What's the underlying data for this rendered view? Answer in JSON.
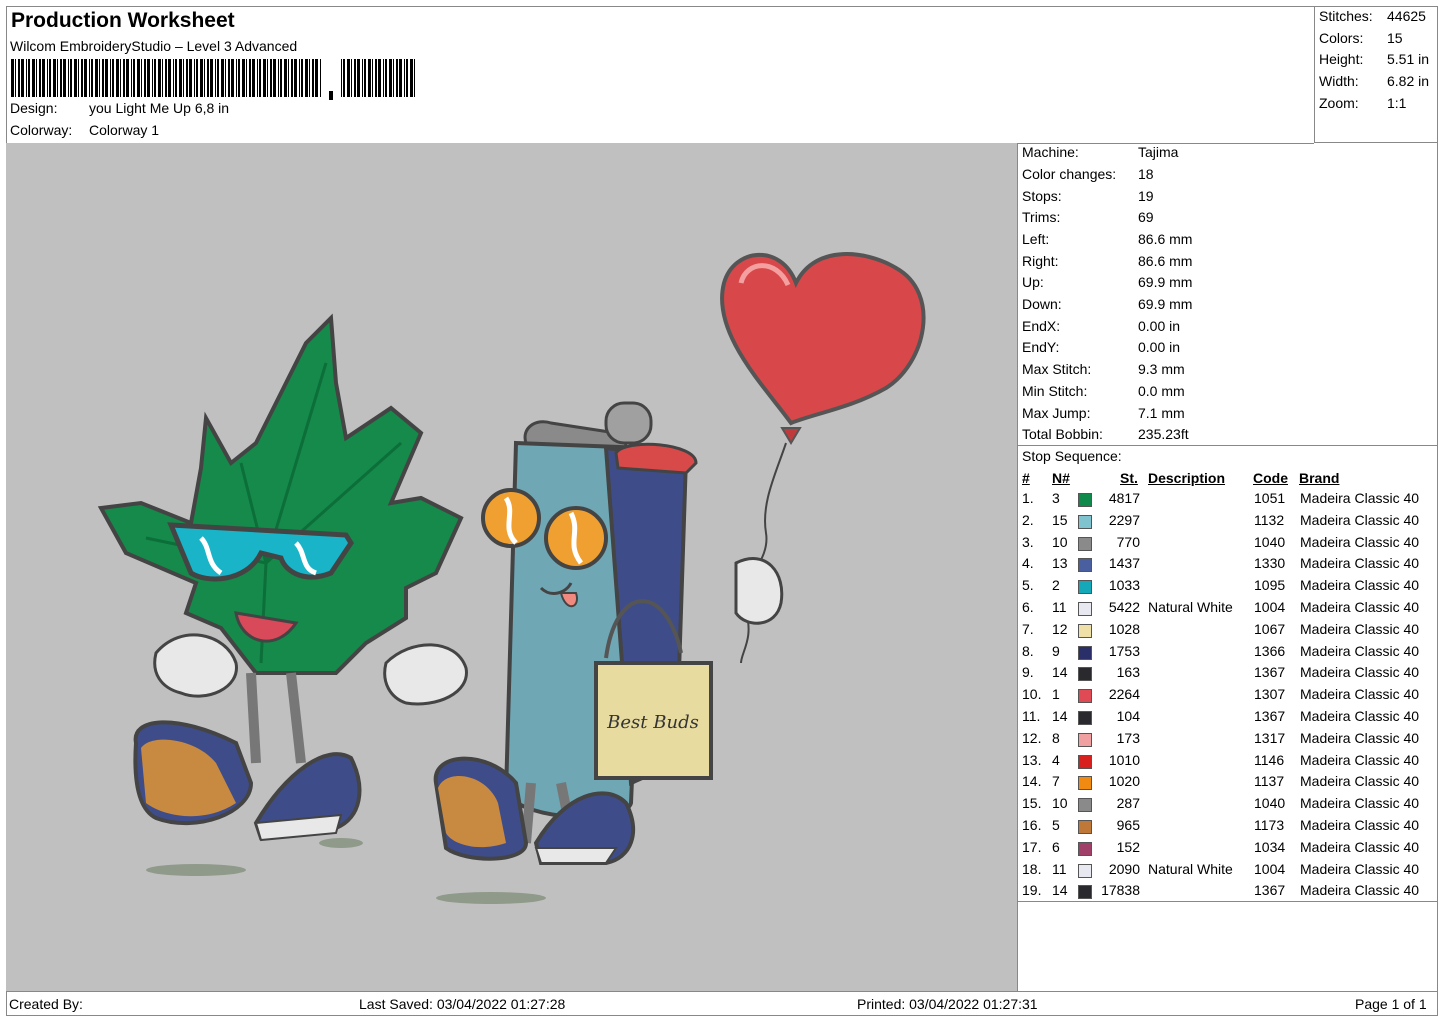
{
  "header": {
    "title": "Production Worksheet",
    "software": "Wilcom EmbroideryStudio – Level 3 Advanced",
    "design_label": "Design:",
    "design_value": "you Light Me Up 6,8 in",
    "colorway_label": "Colorway:",
    "colorway_value": "Colorway 1"
  },
  "stats": [
    {
      "label": "Stitches:",
      "value": "44625"
    },
    {
      "label": "Colors:",
      "value": "15"
    },
    {
      "label": "Height:",
      "value": "5.51 in"
    },
    {
      "label": "Width:",
      "value": "6.82 in"
    },
    {
      "label": "Zoom:",
      "value": "1:1"
    }
  ],
  "props": [
    {
      "label": "Machine:",
      "value": "Tajima"
    },
    {
      "label": "Color changes:",
      "value": "18"
    },
    {
      "label": "Stops:",
      "value": "19"
    },
    {
      "label": "Trims:",
      "value": "69"
    },
    {
      "label": "Left:",
      "value": "86.6 mm"
    },
    {
      "label": "Right:",
      "value": "86.6 mm"
    },
    {
      "label": "Up:",
      "value": "69.9 mm"
    },
    {
      "label": "Down:",
      "value": "69.9 mm"
    },
    {
      "label": "EndX:",
      "value": "0.00 in"
    },
    {
      "label": "EndY:",
      "value": "0.00 in"
    },
    {
      "label": "Max Stitch:",
      "value": "9.3 mm"
    },
    {
      "label": "Min Stitch:",
      "value": "0.0 mm"
    },
    {
      "label": "Max Jump:",
      "value": "7.1 mm"
    },
    {
      "label": "Total Bobbin:",
      "value": "235.23ft"
    }
  ],
  "stop_sequence": {
    "title": "Stop Sequence:",
    "headers": {
      "num": "#",
      "n": "N#",
      "st": "St.",
      "desc": "Description",
      "code": "Code",
      "brand": "Brand"
    },
    "rows": [
      {
        "num": "1.",
        "n": "3",
        "color": "#0f8a4a",
        "st": "4817",
        "desc": "",
        "code": "1051",
        "brand": "Madeira Classic 40"
      },
      {
        "num": "2.",
        "n": "15",
        "color": "#7fc3cf",
        "st": "2297",
        "desc": "",
        "code": "1132",
        "brand": "Madeira Classic 40"
      },
      {
        "num": "3.",
        "n": "10",
        "color": "#8a8a8a",
        "st": "770",
        "desc": "",
        "code": "1040",
        "brand": "Madeira Classic 40"
      },
      {
        "num": "4.",
        "n": "13",
        "color": "#4a5fa0",
        "st": "1437",
        "desc": "",
        "code": "1330",
        "brand": "Madeira Classic 40"
      },
      {
        "num": "5.",
        "n": "2",
        "color": "#15a8b8",
        "st": "1033",
        "desc": "",
        "code": "1095",
        "brand": "Madeira Classic 40"
      },
      {
        "num": "6.",
        "n": "11",
        "color": "#e8e8f0",
        "st": "5422",
        "desc": "Natural White",
        "code": "1004",
        "brand": "Madeira Classic 40"
      },
      {
        "num": "7.",
        "n": "12",
        "color": "#efe0a8",
        "st": "1028",
        "desc": "",
        "code": "1067",
        "brand": "Madeira Classic 40"
      },
      {
        "num": "8.",
        "n": "9",
        "color": "#2a2f6a",
        "st": "1753",
        "desc": "",
        "code": "1366",
        "brand": "Madeira Classic 40"
      },
      {
        "num": "9.",
        "n": "14",
        "color": "#2a2a2e",
        "st": "163",
        "desc": "",
        "code": "1367",
        "brand": "Madeira Classic 40"
      },
      {
        "num": "10.",
        "n": "1",
        "color": "#e04a55",
        "st": "2264",
        "desc": "",
        "code": "1307",
        "brand": "Madeira Classic 40"
      },
      {
        "num": "11.",
        "n": "14",
        "color": "#2a2a2e",
        "st": "104",
        "desc": "",
        "code": "1367",
        "brand": "Madeira Classic 40"
      },
      {
        "num": "12.",
        "n": "8",
        "color": "#f0a0a0",
        "st": "173",
        "desc": "",
        "code": "1317",
        "brand": "Madeira Classic 40"
      },
      {
        "num": "13.",
        "n": "4",
        "color": "#d8201e",
        "st": "1010",
        "desc": "",
        "code": "1146",
        "brand": "Madeira Classic 40"
      },
      {
        "num": "14.",
        "n": "7",
        "color": "#f08a10",
        "st": "1020",
        "desc": "",
        "code": "1137",
        "brand": "Madeira Classic 40"
      },
      {
        "num": "15.",
        "n": "10",
        "color": "#8a8a8a",
        "st": "287",
        "desc": "",
        "code": "1040",
        "brand": "Madeira Classic 40"
      },
      {
        "num": "16.",
        "n": "5",
        "color": "#c07838",
        "st": "965",
        "desc": "",
        "code": "1173",
        "brand": "Madeira Classic 40"
      },
      {
        "num": "17.",
        "n": "6",
        "color": "#a04068",
        "st": "152",
        "desc": "",
        "code": "1034",
        "brand": "Madeira Classic 40"
      },
      {
        "num": "18.",
        "n": "11",
        "color": "#e8e8f0",
        "st": "2090",
        "desc": "Natural White",
        "code": "1004",
        "brand": "Madeira Classic 40"
      },
      {
        "num": "19.",
        "n": "14",
        "color": "#2a2a2e",
        "st": "17838",
        "desc": "",
        "code": "1367",
        "brand": "Madeira Classic 40"
      }
    ]
  },
  "footer": {
    "created_by": "Created By:",
    "last_saved": "Last Saved: 03/04/2022 01:27:28",
    "printed": "Printed: 03/04/2022 01:27:31",
    "page": "Page 1 of 1"
  },
  "design_canvas": {
    "background": "#c0c0c0",
    "bag_text": "Best Buds"
  }
}
